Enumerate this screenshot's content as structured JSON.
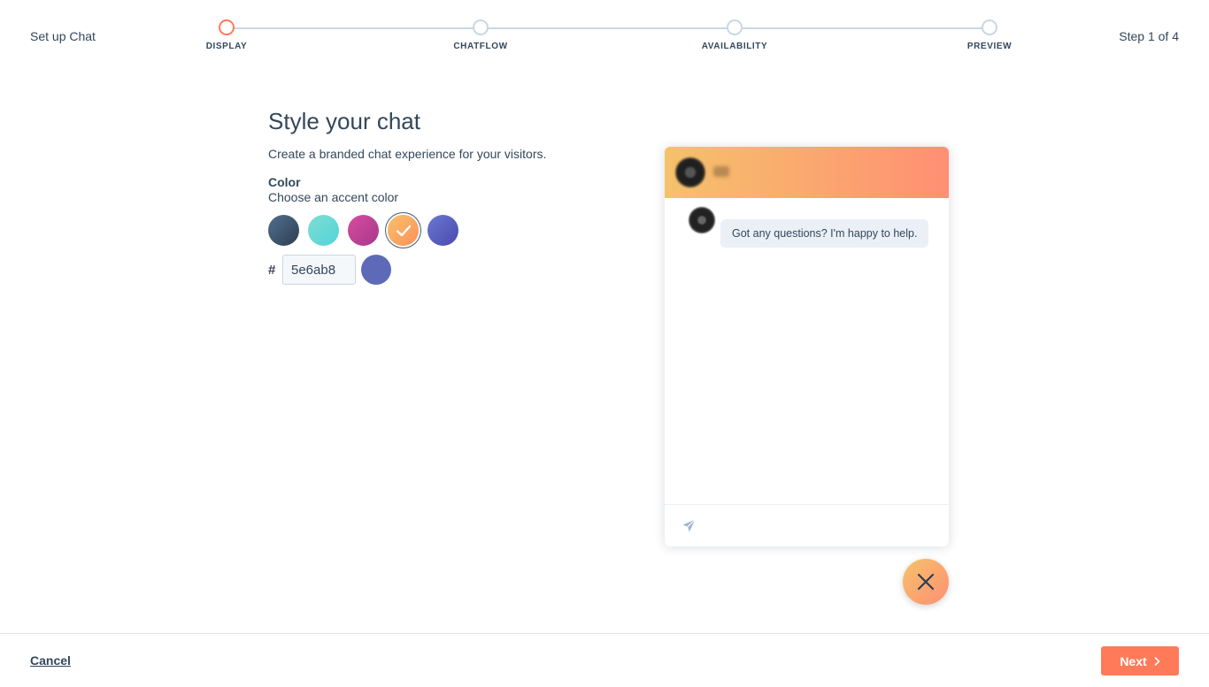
{
  "header": {
    "app_title": "Set up Chat",
    "step_counter": "Step 1 of 4",
    "steps": [
      {
        "label": "DISPLAY",
        "active": true
      },
      {
        "label": "CHATFLOW",
        "active": false
      },
      {
        "label": "AVAILABILITY",
        "active": false
      },
      {
        "label": "PREVIEW",
        "active": false
      }
    ]
  },
  "main": {
    "title": "Style your chat",
    "subtitle": "Create a branded chat experience for your visitors.",
    "color_label": "Color",
    "color_description": "Choose an accent color",
    "swatches": [
      {
        "name": "navy",
        "from": "#516f90",
        "to": "#2d3e50",
        "selected": false
      },
      {
        "name": "teal",
        "from": "#7fded2",
        "to": "#51d3d9",
        "selected": false
      },
      {
        "name": "magenta",
        "from": "#d94c9e",
        "to": "#a5388e",
        "selected": false
      },
      {
        "name": "orange",
        "from": "#f5c26b",
        "to": "#ff8f59",
        "selected": true
      },
      {
        "name": "indigo",
        "from": "#6a78d1",
        "to": "#4a4aad",
        "selected": false
      }
    ],
    "hash_symbol": "#",
    "hex_value": "5e6ab8",
    "custom_color": "#5e6ab8"
  },
  "preview": {
    "header_gradient_from": "#f5c26b",
    "header_gradient_to": "#ff8f73",
    "message": "Got any questions? I'm happy to help.",
    "send_icon": "paper-plane-icon",
    "launcher_icon": "close-icon"
  },
  "footer": {
    "cancel_label": "Cancel",
    "next_label": "Next",
    "next_color": "#ff7a59"
  },
  "colors": {
    "accent": "#ff7a59",
    "text": "#33475b"
  }
}
